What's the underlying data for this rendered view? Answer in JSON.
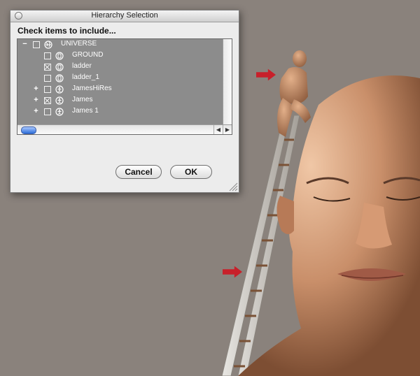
{
  "window": {
    "title": "Hierarchy Selection",
    "prompt": "Check items to include..."
  },
  "tree": {
    "items": [
      {
        "label": "UNIVERSE",
        "expander": "−",
        "checked": false,
        "icon": "globe-icon"
      },
      {
        "label": "GROUND",
        "expander": "",
        "checked": false,
        "icon": "prop-icon"
      },
      {
        "label": "ladder",
        "expander": "",
        "checked": true,
        "icon": "prop-icon"
      },
      {
        "label": "ladder_1",
        "expander": "",
        "checked": false,
        "icon": "prop-icon"
      },
      {
        "label": "JamesHiRes",
        "expander": "+",
        "checked": false,
        "icon": "figure-icon"
      },
      {
        "label": "James",
        "expander": "+",
        "checked": true,
        "icon": "figure-icon"
      },
      {
        "label": "James 1",
        "expander": "+",
        "checked": false,
        "icon": "figure-icon"
      }
    ]
  },
  "buttons": {
    "cancel": "Cancel",
    "ok": "OK"
  },
  "colors": {
    "background": "#8a827c",
    "tree_bg": "#8c8c8c",
    "annotation_arrow": "#c8202a",
    "skin": "#c98f6a"
  }
}
